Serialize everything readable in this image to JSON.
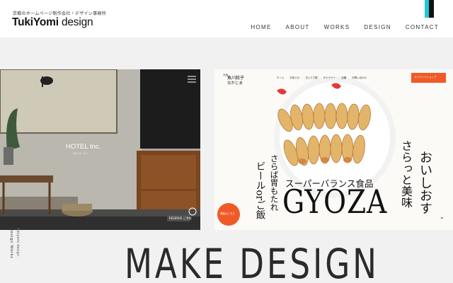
{
  "header": {
    "tagline": "京都のホームページ制作会社・デザイン事務所",
    "logo_bold": "TukiYomi",
    "logo_thin": " design",
    "nav": [
      "HOME",
      "ABOUT",
      "WORKS",
      "DESIGN",
      "CONTACT"
    ]
  },
  "card1": {
    "brand": "HOTEL Inc.",
    "brand_sub": "ホテル イン",
    "badge": "RESERVE ご予約"
  },
  "card2": {
    "shop_small": "元祖",
    "shop_name": "魚川餃子",
    "shop_name2": "なかじま",
    "nav": [
      "ホーム",
      "お知らせ",
      "ぎょうざ屋",
      "ギャラリー",
      "店舗",
      "お問い合わせ"
    ],
    "online_button": "オンラインショップ",
    "headline_right": "おいしおす",
    "headline_right2": "さらっと美味",
    "headline_left": "さらば胃もたれ",
    "headline_left2": "ビールorご飯",
    "subtitle": "スーパーバランス食品",
    "title": "GYOZA",
    "badge": "電話はこちら"
  },
  "side_label": "Design Works",
  "side_sub": "tukiyomi design",
  "make_design": "MAKE DESIGN",
  "colors": {
    "accent_cyan": "#1ec8d6",
    "accent_dark": "#111111",
    "cta_orange": "#f05a28"
  }
}
